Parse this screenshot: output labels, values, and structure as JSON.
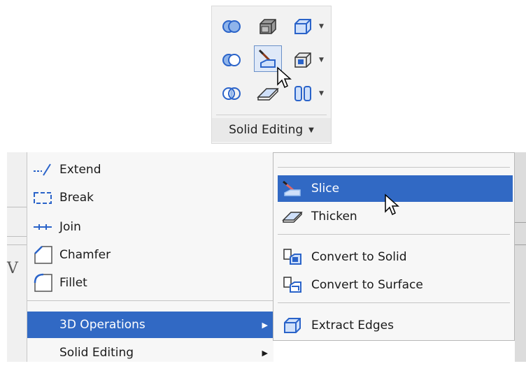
{
  "ribbon": {
    "panel_label": "Solid Editing",
    "buttons": [
      {
        "icon": "union-icon"
      },
      {
        "icon": "extrude-faces-icon"
      },
      {
        "icon": "separate-icon"
      },
      {
        "icon": "subtract-icon"
      },
      {
        "icon": "slice-icon",
        "active": true
      },
      {
        "icon": "imprint-icon"
      },
      {
        "icon": "intersect-icon"
      },
      {
        "icon": "thicken-icon"
      },
      {
        "icon": "shell-icon"
      }
    ]
  },
  "menu": {
    "items": [
      {
        "label": "Extend",
        "icon": "extend-icon"
      },
      {
        "label": "Break",
        "icon": "break-icon"
      },
      {
        "label": "Join",
        "icon": "join-icon"
      },
      {
        "label": "Chamfer",
        "icon": "chamfer-icon"
      },
      {
        "label": "Fillet",
        "icon": "fillet-icon"
      },
      {
        "label": "3D Operations",
        "highlighted": true
      },
      {
        "label": "Solid Editing"
      }
    ]
  },
  "submenu": {
    "items": [
      {
        "label": "Slice",
        "icon": "slice-icon",
        "highlighted": true
      },
      {
        "label": "Thicken",
        "icon": "thicken-icon"
      },
      {
        "label": "Convert to Solid",
        "icon": "convert-to-solid-icon"
      },
      {
        "label": "Convert to Surface",
        "icon": "convert-to-surface-icon"
      },
      {
        "label": "Extract Edges",
        "icon": "extract-edges-icon"
      }
    ]
  },
  "colors": {
    "highlight": "#3169c4",
    "icon_blue": "#2a63c9",
    "menu_bg": "#f7f7f7"
  }
}
